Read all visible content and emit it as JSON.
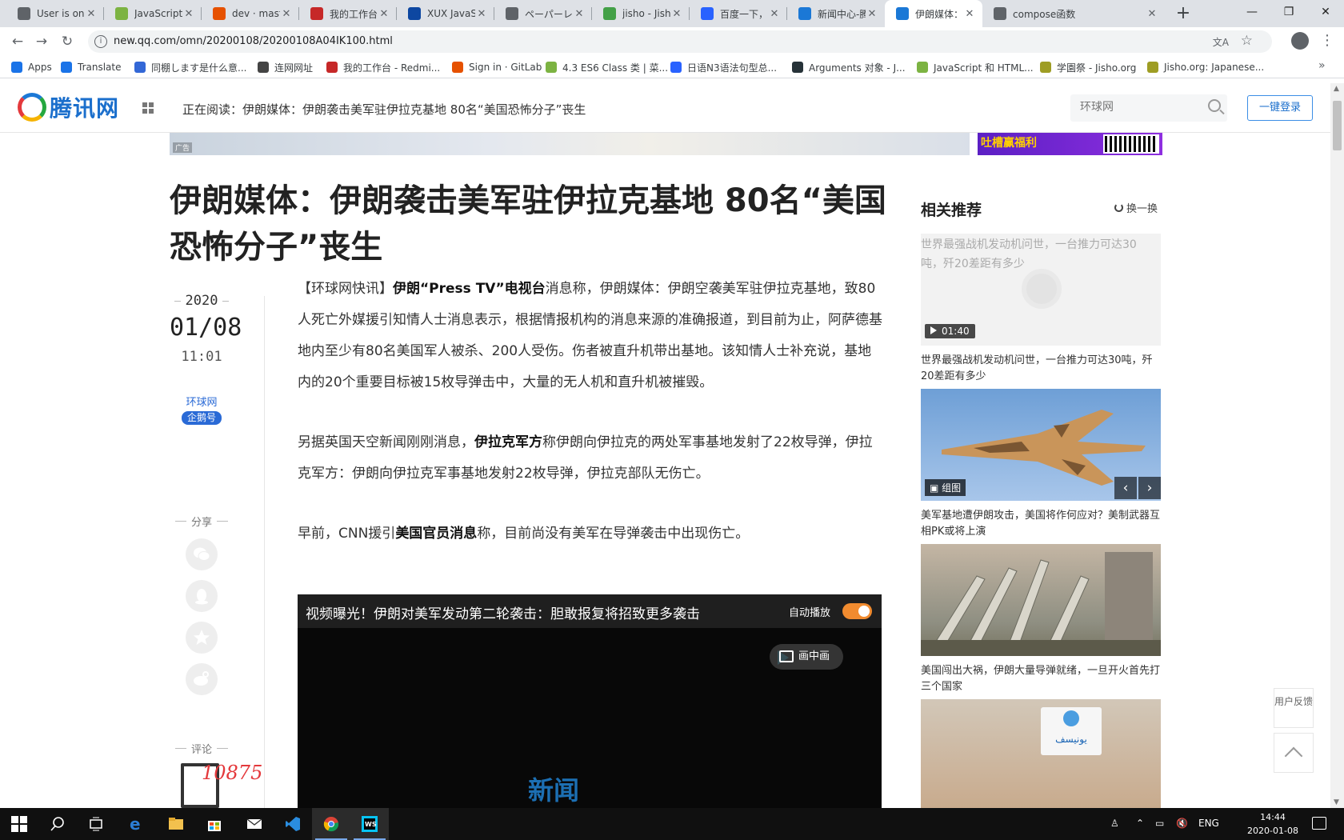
{
  "browser": {
    "tabs": [
      {
        "title": "User is online",
        "color": "#5f6368"
      },
      {
        "title": "JavaScript Ar",
        "color": "#7cb342"
      },
      {
        "title": "dev · master",
        "color": "#e65100"
      },
      {
        "title": "我的工作台 -",
        "color": "#c62828"
      },
      {
        "title": "XUX JavaScri",
        "color": "#0d47a1"
      },
      {
        "title": "ペーパーレスファ",
        "color": "#5f6368"
      },
      {
        "title": "jisho - Jisho.",
        "color": "#43a047"
      },
      {
        "title": "百度一下，你",
        "color": "#2962ff"
      },
      {
        "title": "新闻中心-腾",
        "color": "#1b78d6"
      },
      {
        "title": "伊朗媒体：伊",
        "color": "#1b78d6",
        "active": true
      },
      {
        "title": "compose函数",
        "color": "#5f6368"
      }
    ],
    "new_tab": "+",
    "url": "new.qq.com/omn/20200108/20200108A04IK100.html",
    "bookmarks": [
      {
        "label": "Apps",
        "color": "#1a73e8"
      },
      {
        "label": "Translate",
        "color": "#1a73e8"
      },
      {
        "label": "同棚します是什么意...",
        "color": "#3367d6"
      },
      {
        "label": "连网网址",
        "color": "#444"
      },
      {
        "label": "我的工作台 - Redmi...",
        "color": "#c62828"
      },
      {
        "label": "Sign in · GitLab",
        "color": "#e65100"
      },
      {
        "label": "4.3 ES6 Class 类 | 菜...",
        "color": "#7cb342"
      },
      {
        "label": "日语N3语法句型总...",
        "color": "#2962ff"
      },
      {
        "label": "Arguments 对象 - J...",
        "color": "#263238"
      },
      {
        "label": "JavaScript 和 HTML...",
        "color": "#7cb342"
      },
      {
        "label": "学園祭 - Jisho.org",
        "color": "#9e9d24"
      },
      {
        "label": "Jisho.org: Japanese...",
        "color": "#9e9d24"
      }
    ]
  },
  "site": {
    "logo_text": "腾讯网",
    "reading": "正在阅读：伊朗媒体：伊朗袭击美军驻伊拉克基地 80名“美国恐怖分子”丧生",
    "search_placeholder": "环球网",
    "login": "一键登录",
    "ad_tag": "广告",
    "ad_text": "吐槽赢福利"
  },
  "article": {
    "headline": "伊朗媒体：伊朗袭击美军驻伊拉克基地 80名“美国恐怖分子”丧生",
    "year": "2020",
    "month_day": "01/08",
    "time": "11:01",
    "source": "环球网",
    "badge": "企鹅号",
    "share_label": "分享",
    "comment_label": "评论",
    "comment_count": "10875",
    "p1_a": "【环球网快讯】",
    "p1_b": "伊朗“Press TV”电视台",
    "p1_c": "消息称，伊朗媒体：伊朗空袭美军驻伊拉克基地，致80人死亡外媒援引知情人士消息表示，根据情报机构的消息来源的准确报道，到目前为止，阿萨德基地内至少有80名美国军人被杀、200人受伤。伤者被直升机带出基地。该知情人士补充说，基地内的20个重要目标被15枚导弹击中，大量的无人机和直升机被摧毁。",
    "p2_a": "另据英国天空新闻刚刚消息，",
    "p2_b": "伊拉克军方",
    "p2_c": "称伊朗向伊拉克的两处军事基地发射了22枚导弹，伊拉克军方：伊朗向伊拉克军事基地发射22枚导弹，伊拉克部队无伤亡。",
    "p3_a": "早前，CNN援引",
    "p3_b": "美国官员消息",
    "p3_c": "称，目前尚没有美军在导弹袭击中出现伤亡。",
    "video_title": "视频曝光！伊朗对美军发动第二轮袭击：胆敢报复将招致更多袭击",
    "autoplay": "自动播放",
    "autoplay_on": true,
    "pip": "画中画",
    "watermark": "新闻"
  },
  "sidebar": {
    "title": "相关推荐",
    "refresh": "换一换",
    "cards": [
      {
        "alt": "世界最强战机发动机问世，一台推力可达30吨，歼20差距有多少",
        "badge": "01:40",
        "caption": "世界最强战机发动机问世，一台推力可达30吨，歼20差距有多少"
      },
      {
        "badge": "组图",
        "caption": "美军基地遭伊朗攻击，美国将作何应对？美制武器互相PK或将上演"
      },
      {
        "caption": "美国闯出大祸，伊朗大量导弹就绪，一旦开火首先打三个国家"
      },
      {
        "sign": "يونيسف"
      }
    ],
    "feedback": "用户反馈"
  },
  "taskbar": {
    "lang": "ENG",
    "time": "14:44",
    "date": "2020-01-08"
  }
}
